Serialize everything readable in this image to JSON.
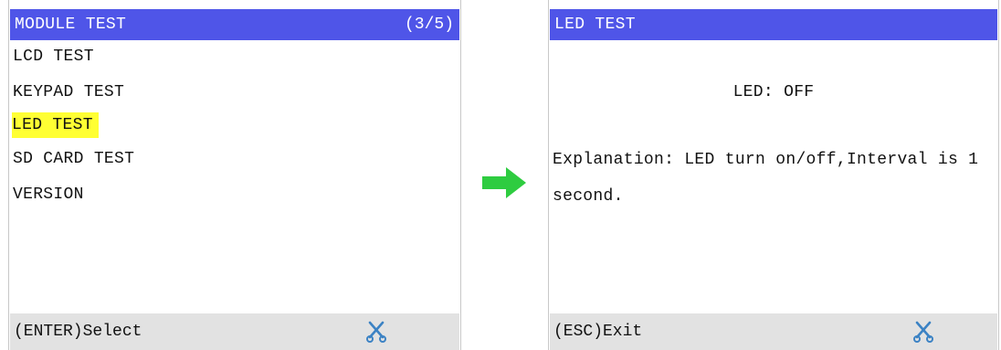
{
  "module_screen": {
    "title": "MODULE TEST",
    "page_indicator": "(3/5)",
    "items": [
      {
        "label": "LCD TEST",
        "selected": false
      },
      {
        "label": "KEYPAD TEST",
        "selected": false
      },
      {
        "label": "LED TEST",
        "selected": true
      },
      {
        "label": "SD CARD TEST",
        "selected": false
      },
      {
        "label": "VERSION",
        "selected": false
      }
    ],
    "status": "(ENTER)Select",
    "status_icon": "tools-icon"
  },
  "led_screen": {
    "title": "LED TEST",
    "led_status": "LED: OFF",
    "explanation": "Explanation: LED turn on/off,Interval is 1 second.",
    "status": "(ESC)Exit",
    "status_icon": "tools-icon"
  },
  "arrow_icon": "right-arrow-icon",
  "colors": {
    "title_bar": "#4f55e8",
    "selection_highlight": "#ffff33",
    "status_bar": "#e2e2e2",
    "arrow": "#2ecc40",
    "tool_icon": "#3b82c4"
  }
}
